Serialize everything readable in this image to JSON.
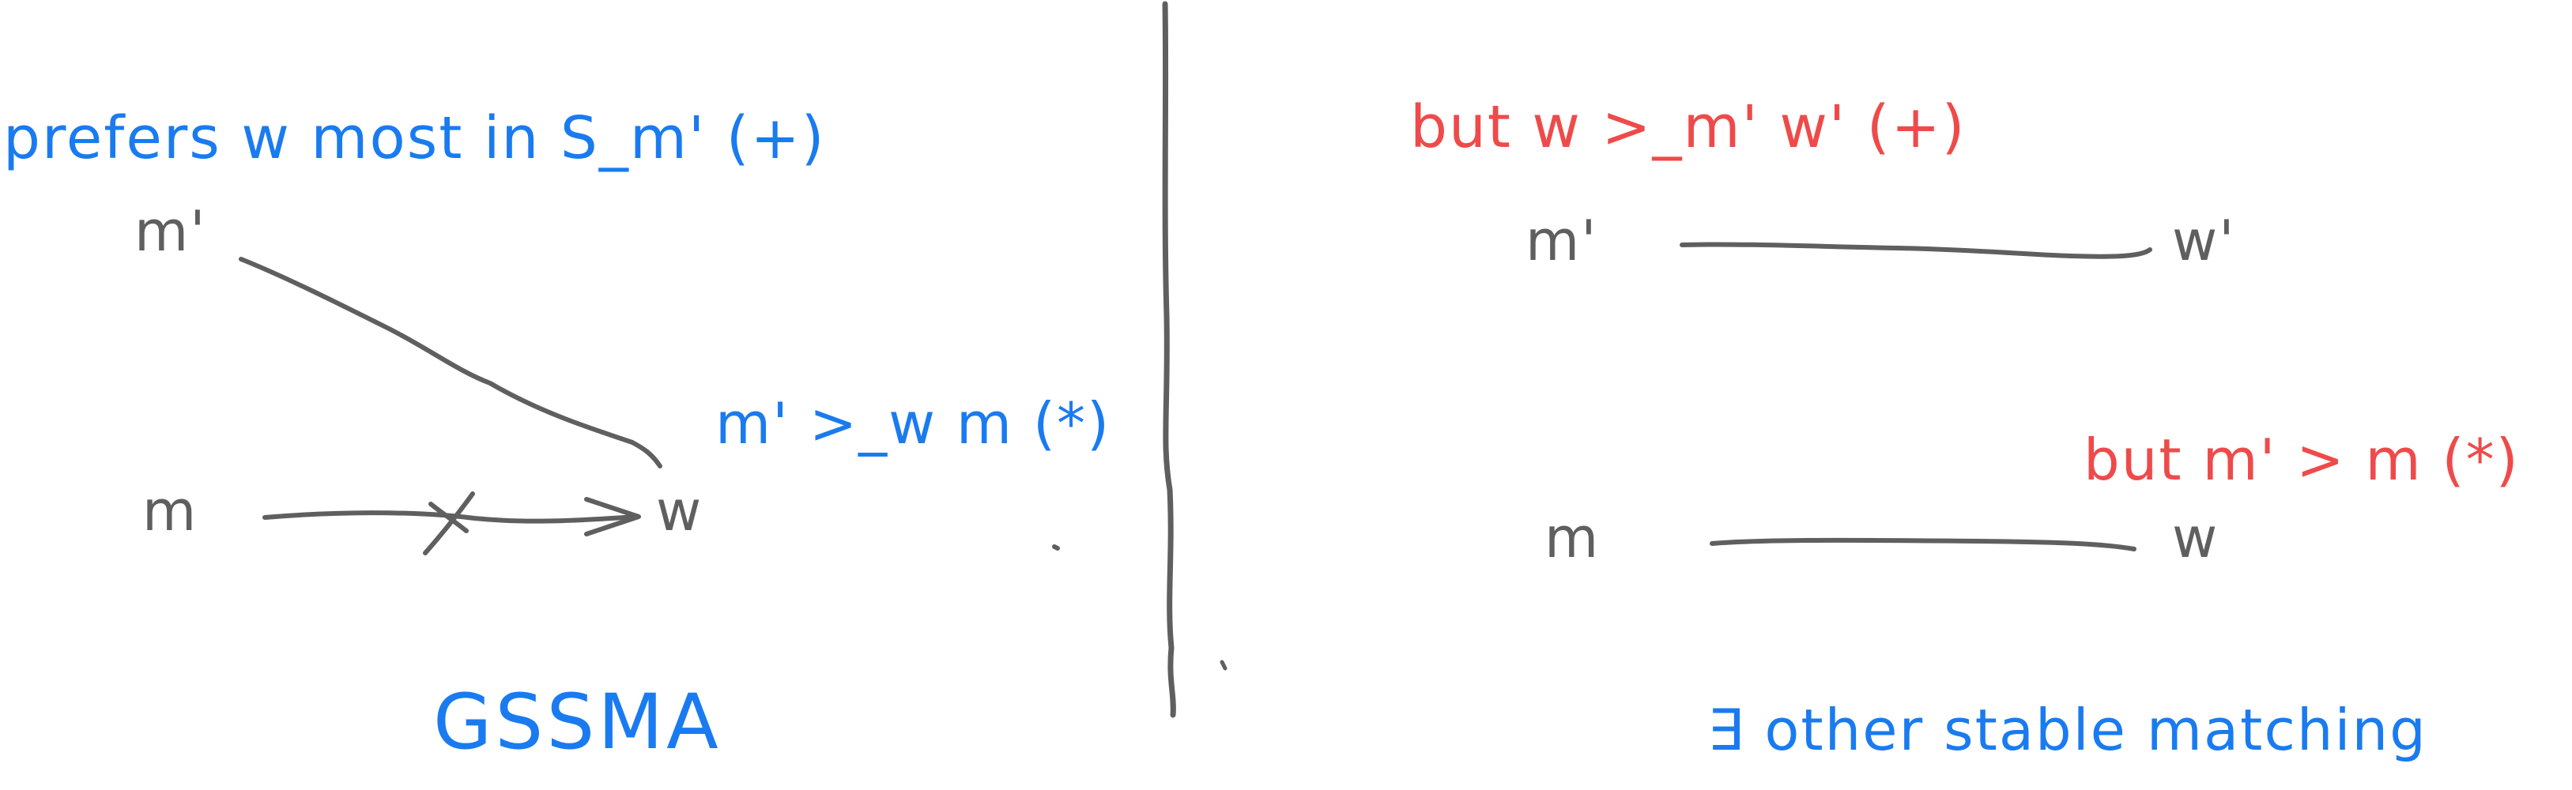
{
  "colors": {
    "blue_ink": "#1a7bf0",
    "red_ink": "#ef4a4a",
    "gray_ink": "#5f5f5f",
    "background": "#ffffff"
  },
  "left": {
    "note_top": "prefers w most in S_m' (+)",
    "node_m_prime": "m'",
    "node_m": "m",
    "node_w": "w",
    "note_right": "m' >_w m (*)",
    "caption": "GSSMA"
  },
  "right": {
    "note_top": "but w >_m' w' (+)",
    "node_m_prime": "m'",
    "node_w_prime": "w'",
    "node_m": "m",
    "node_w": "w",
    "note_mid": "but m' > m (*)",
    "caption": "∃ other stable matching"
  }
}
